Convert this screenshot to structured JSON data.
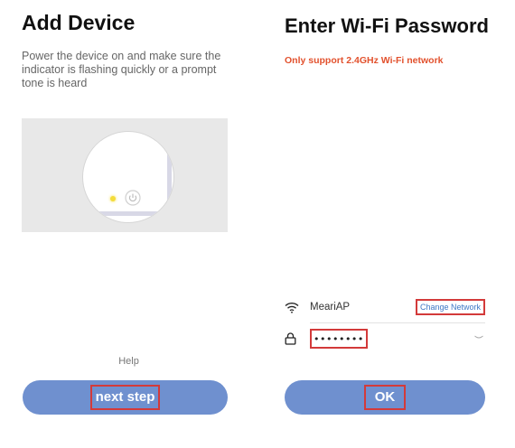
{
  "add_device": {
    "title": "Add Device",
    "description": "Power the device on and make sure the indicator is flashing quickly or a prompt tone is heard",
    "help_label": "Help",
    "next_label": "next step"
  },
  "wifi": {
    "title": "Enter Wi-Fi Password",
    "notice": "Only support 2.4GHz Wi-Fi network",
    "ssid": "MeariAP",
    "change_network_label": "Change Network",
    "password_masked": "••••••••",
    "ok_label": "OK"
  },
  "icons": {
    "wifi": "wifi-icon",
    "lock": "lock-icon",
    "power": "power-icon",
    "eye": "eye-closed-icon"
  },
  "colors": {
    "button": "#6f90cf",
    "warning": "#e2512d",
    "highlight_box": "#d33a3a",
    "link": "#3e78c5",
    "indicator": "#f4dc3a"
  }
}
